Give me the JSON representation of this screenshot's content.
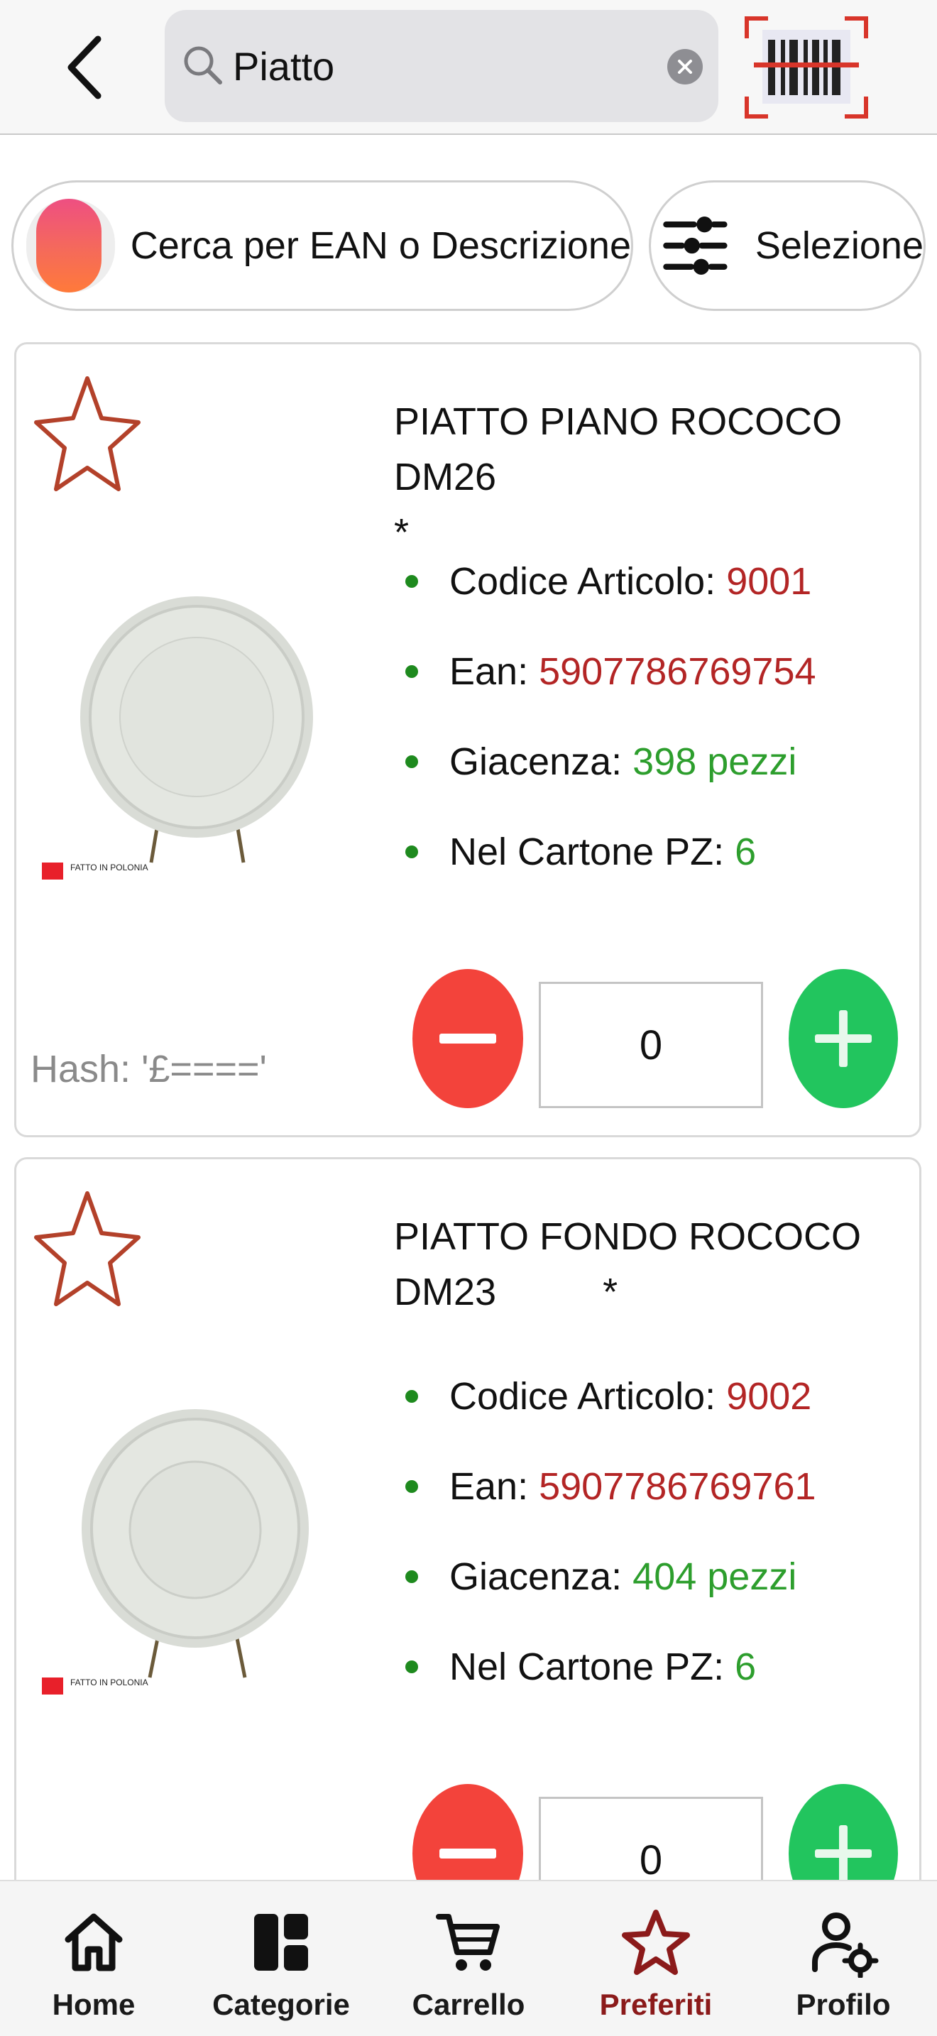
{
  "header": {
    "search_value": "Piatto"
  },
  "filters": {
    "search_mode_label": "Cerca per EAN o Descrizione",
    "selection_label": "Selezione"
  },
  "products": [
    {
      "title": "PIATTO PIANO ROCOCO DM26\n*",
      "code_label": "Codice Articolo: ",
      "code": "9001",
      "ean_label": "Ean: ",
      "ean": "5907786769754",
      "stock_label": "Giacenza: ",
      "stock": "398 pezzi",
      "carton_label": "Nel Cartone PZ: ",
      "carton": "6",
      "image_caption": "FATTO IN POLONIA",
      "hash": "Hash: '£===='",
      "quantity": "0"
    },
    {
      "title": "PIATTO FONDO ROCOCO\nDM23          *",
      "code_label": "Codice Articolo: ",
      "code": "9002",
      "ean_label": "Ean: ",
      "ean": "5907786769761",
      "stock_label": "Giacenza: ",
      "stock": "404 pezzi",
      "carton_label": "Nel Cartone PZ: ",
      "carton": "6",
      "image_caption": "FATTO IN POLONIA",
      "quantity": "0"
    }
  ],
  "bottom_nav": [
    {
      "label": "Home",
      "icon": "home-icon"
    },
    {
      "label": "Categorie",
      "icon": "categories-icon"
    },
    {
      "label": "Carrello",
      "icon": "cart-icon"
    },
    {
      "label": "Preferiti",
      "icon": "star-icon",
      "active": true
    },
    {
      "label": "Profilo",
      "icon": "profile-settings-icon"
    }
  ],
  "colors": {
    "accent": "#8b1a1a",
    "minus": "#f3433b",
    "plus": "#22c55e",
    "value_red": "#b32525",
    "value_green": "#2d9e2d"
  }
}
